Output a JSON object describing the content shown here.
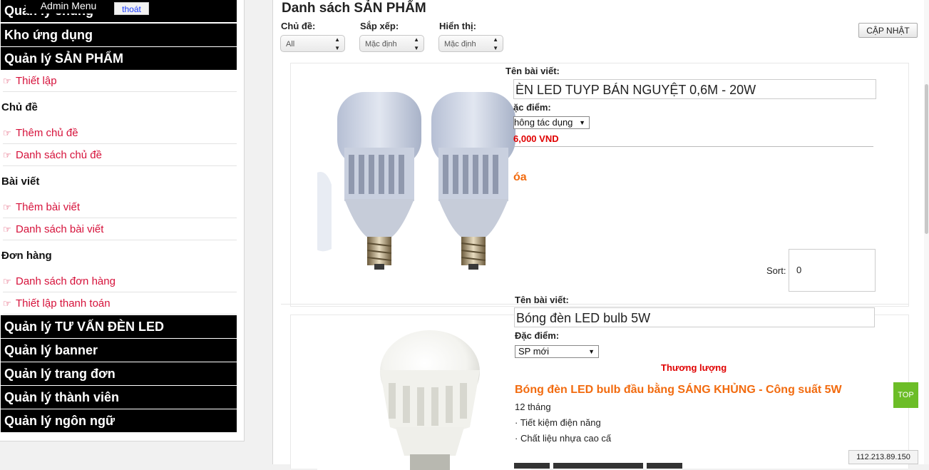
{
  "sidebar": {
    "top_block": "Quản lý chung",
    "admin_tab": "Admin Menu",
    "logout": "thoát",
    "blocks_top": [
      "Kho ứng dụng",
      "Quản lý SẢN PHẨM"
    ],
    "setting_link": "Thiết lập",
    "sections": [
      {
        "heading": "Chủ đề",
        "links": [
          "Thêm chủ đề",
          "Danh sách chủ đề"
        ]
      },
      {
        "heading": "Bài viết",
        "links": [
          "Thêm bài viết",
          "Danh sách bài viết"
        ]
      },
      {
        "heading": "Đơn hàng",
        "links": [
          "Danh sách đơn hàng",
          "Thiết lập thanh toán"
        ]
      }
    ],
    "blocks_bottom": [
      "Quản lý TƯ VẤN ĐÈN LED",
      "Quản lý banner",
      "Quản lý trang đơn",
      "Quản lý thành viên",
      "Quản lý ngôn ngữ"
    ]
  },
  "main": {
    "title": "Danh sách SẢN PHẨM",
    "filters": [
      {
        "label": "Chủ đề:",
        "value": "All"
      },
      {
        "label": "Sắp xếp:",
        "value": "Mặc định"
      },
      {
        "label": "Hiển thị:",
        "value": "Mặc định"
      }
    ],
    "update_button": "CẬP NHẬT",
    "products": [
      {
        "name_label": "Tên bài viết:",
        "name_value": "ÈN LED TUYP BÁN NGUYỆT 0,6M - 20W",
        "feature_label": "ặc điểm:",
        "feature_value": "hông tác dụng",
        "price": "6,000 VND",
        "orange": "óa",
        "sort_label": "Sort:",
        "sort_value": "0"
      },
      {
        "name_label": "Tên bài viết:",
        "name_value": "Bóng đèn LED bulb  5W",
        "feature_label": "Đặc điểm:",
        "feature_value": "SP mới",
        "price": "Thương lượng",
        "orange": "Bóng đèn LED bulb đầu bằng SÁNG KHỦNG - Công suất 5W",
        "lines": [
          "12 tháng",
          "· Tiết kiệm điện năng",
          "· Chất liệu nhựa cao cấ"
        ]
      }
    ]
  },
  "top_button": "TOP",
  "ip_address": "112.213.89.150",
  "colors": {
    "accent_red": "#d6123b",
    "price_red": "#e00000",
    "orange": "#f26b0f",
    "top_green": "#6cbd27"
  }
}
